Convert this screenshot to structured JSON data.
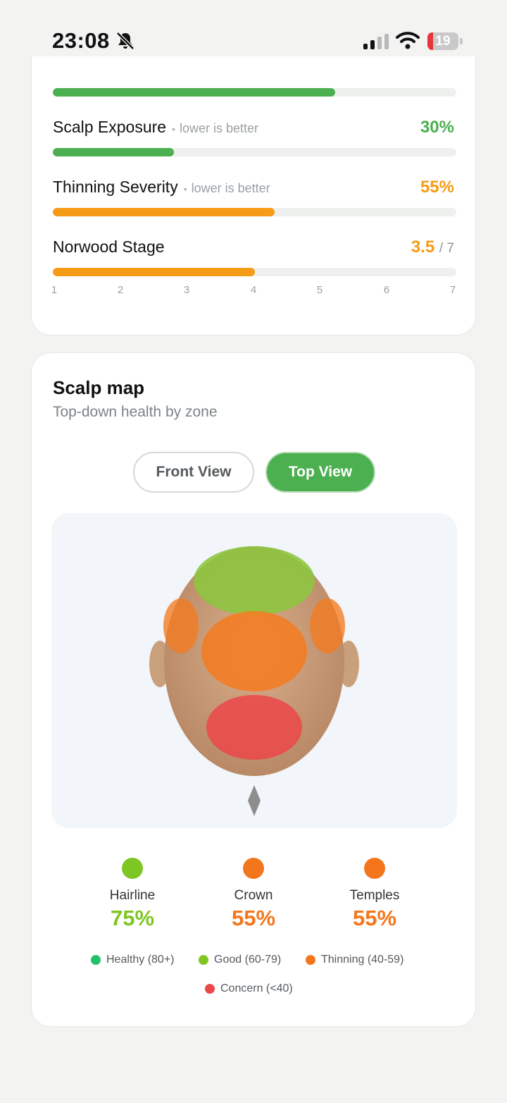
{
  "status_bar": {
    "time": "23:08",
    "battery": "19",
    "battery_level": 0.19
  },
  "metrics": [
    {
      "label": "",
      "note": "",
      "value": "",
      "fill": 0.7,
      "color": "#4caf50"
    },
    {
      "label": "Scalp Exposure",
      "note": "lower is better",
      "value": "30%",
      "fill": 0.3,
      "color": "#4caf50"
    },
    {
      "label": "Thinning Severity",
      "note": "lower is better",
      "value": "55%",
      "fill": 0.55,
      "color": "#f59b16"
    },
    {
      "label": "Norwood Stage",
      "note": "",
      "value": "3.5",
      "value_sub": "/ 7",
      "fill": 0.5,
      "color": "#f59b16"
    }
  ],
  "norwood_scale": [
    "1",
    "2",
    "3",
    "4",
    "5",
    "6",
    "7"
  ],
  "scalp_map": {
    "title": "Scalp map",
    "subtitle": "Top-down health by zone",
    "toggle_front": "Front View",
    "toggle_top": "Top View",
    "active_view": "Top View",
    "zones": [
      {
        "name": "Hairline",
        "value": "75%",
        "color": "#7ec623"
      },
      {
        "name": "Crown",
        "value": "55%",
        "color": "#f4761c"
      },
      {
        "name": "Temples",
        "value": "55%",
        "color": "#f4761c"
      }
    ],
    "legend": [
      {
        "label": "Healthy (80+)",
        "color": "#22c06a"
      },
      {
        "label": "Good (60-79)",
        "color": "#7ec623"
      },
      {
        "label": "Thinning (40-59)",
        "color": "#f4761c"
      },
      {
        "label": "Concern (<40)",
        "color": "#ea4a4a"
      }
    ]
  }
}
